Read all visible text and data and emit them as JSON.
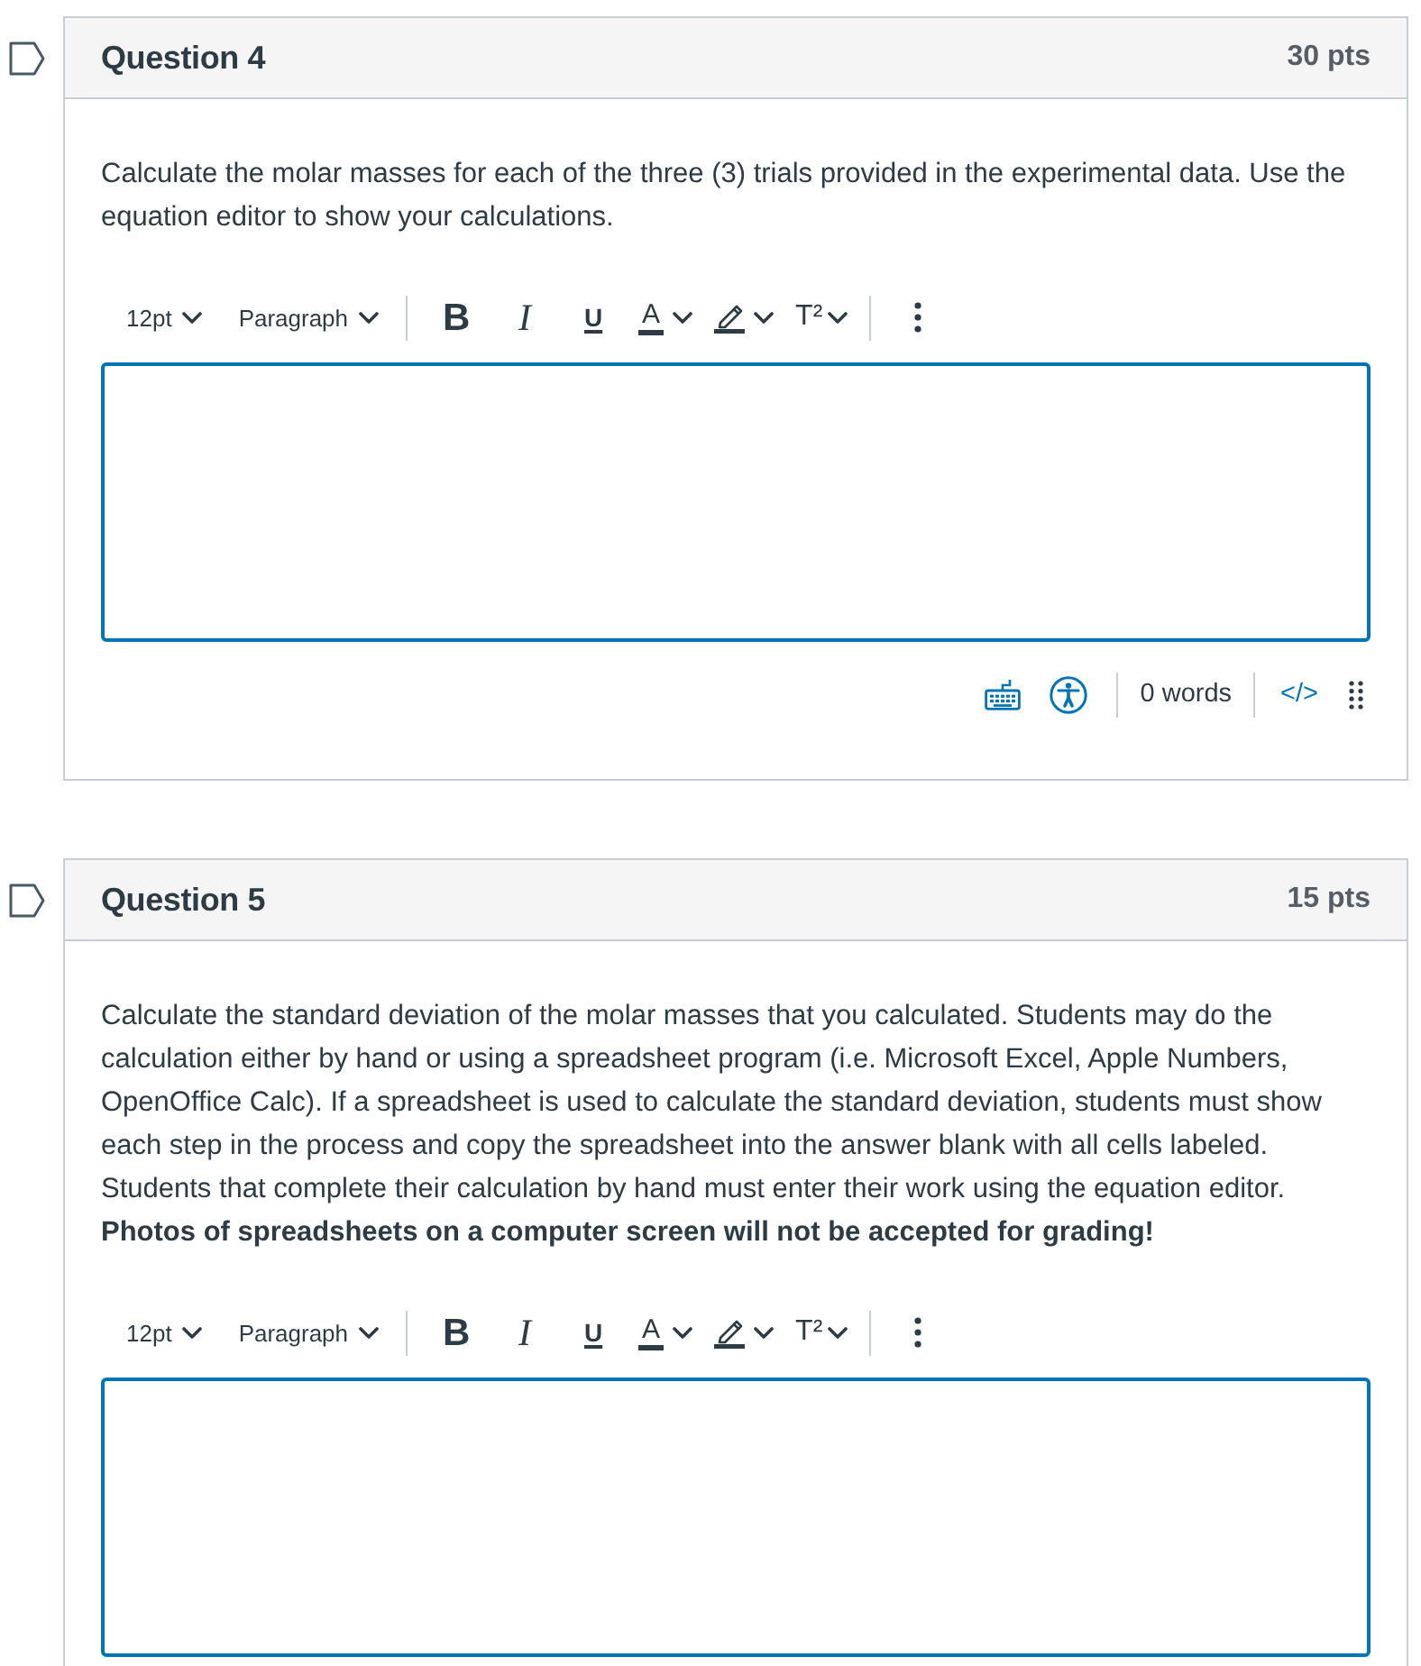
{
  "questions": [
    {
      "title": "Question 4",
      "points": "30 pts",
      "prompt": [
        {
          "text": "Calculate the molar masses for each of the three (3) trials provided in the experimental data. Use the equation editor to show your calculations.",
          "bold": false
        }
      ],
      "editor": {
        "toolbar": {
          "font_size": "12pt",
          "block_format": "Paragraph",
          "buttons": [
            {
              "kind": "bold",
              "label": "B"
            },
            {
              "kind": "italic",
              "label": "I"
            },
            {
              "kind": "underline",
              "label": "U"
            },
            {
              "kind": "text_color",
              "label": "A"
            },
            {
              "kind": "highlight"
            },
            {
              "kind": "superscript",
              "label": "T²"
            }
          ]
        },
        "status_bar": {
          "word_count": "0 words",
          "html_toggle": "</>"
        }
      }
    },
    {
      "title": "Question 5",
      "points": "15 pts",
      "prompt": [
        {
          "text": "Calculate the standard deviation of the molar masses that you calculated. Students may do the calculation either by hand or using a spreadsheet program (i.e. Microsoft Excel, Apple Numbers, OpenOffice Calc). If a spreadsheet is used to calculate the standard deviation, students must show each step in the process and copy the spreadsheet into the answer blank with all cells labeled. Students that complete their calculation by hand must enter their work using the equation editor.",
          "bold": false
        },
        {
          "text": "Photos of spreadsheets on a computer screen will not be accepted for grading!",
          "bold": true
        }
      ],
      "editor": {
        "toolbar": {
          "font_size": "12pt",
          "block_format": "Paragraph",
          "buttons": [
            {
              "kind": "bold",
              "label": "B"
            },
            {
              "kind": "italic",
              "label": "I"
            },
            {
              "kind": "underline",
              "label": "U"
            },
            {
              "kind": "text_color",
              "label": "A"
            },
            {
              "kind": "highlight"
            },
            {
              "kind": "superscript",
              "label": "T²"
            }
          ]
        }
      }
    }
  ]
}
